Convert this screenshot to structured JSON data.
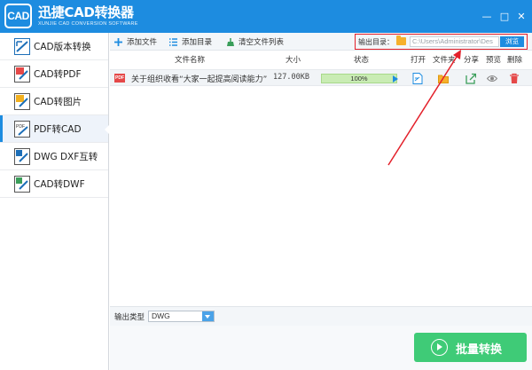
{
  "app": {
    "logo_text": "CAD",
    "title": "迅捷CAD转换器",
    "subtitle": "XUNJIE CAD CONVERSION SOFTWARE",
    "controls": {
      "minimize": "—",
      "maximize": "□",
      "close": "✕"
    }
  },
  "sidebar": {
    "items": [
      {
        "label": "CAD版本转换",
        "icon": "cad-version-icon",
        "active": false
      },
      {
        "label": "CAD转PDF",
        "icon": "cad-to-pdf-icon",
        "active": false
      },
      {
        "label": "CAD转图片",
        "icon": "cad-to-image-icon",
        "active": false
      },
      {
        "label": "PDF转CAD",
        "icon": "pdf-to-cad-icon",
        "active": true
      },
      {
        "label": "DWG DXF互转",
        "icon": "dwg-dxf-icon",
        "active": false
      },
      {
        "label": "CAD转DWF",
        "icon": "cad-to-dwf-icon",
        "active": false
      }
    ]
  },
  "toolbar": {
    "add_file": "添加文件",
    "add_folder": "添加目录",
    "clear_list": "清空文件列表"
  },
  "output_dir": {
    "label": "输出目录：",
    "path": "C:\\Users\\Administrator\\Des",
    "browse": "浏览"
  },
  "columns": {
    "name": "文件名称",
    "size": "大小",
    "status": "状态",
    "open": "打开",
    "folder": "文件夹",
    "share": "分享",
    "preview": "预览",
    "delete": "删除"
  },
  "files": [
    {
      "icon_text": "PDF",
      "name": "关于组织收看“大家一起提高阅读能力”",
      "size": "127.00KB",
      "progress": 100,
      "progress_label": "100%"
    }
  ],
  "output_type": {
    "label": "输出类型",
    "value": "DWG"
  },
  "convert_button": "批量转换",
  "colors": {
    "primary": "#1d8ce0",
    "convert": "#3fcb77",
    "highlight_border": "#e3202a",
    "progress_fill": "#c9ecb4"
  }
}
